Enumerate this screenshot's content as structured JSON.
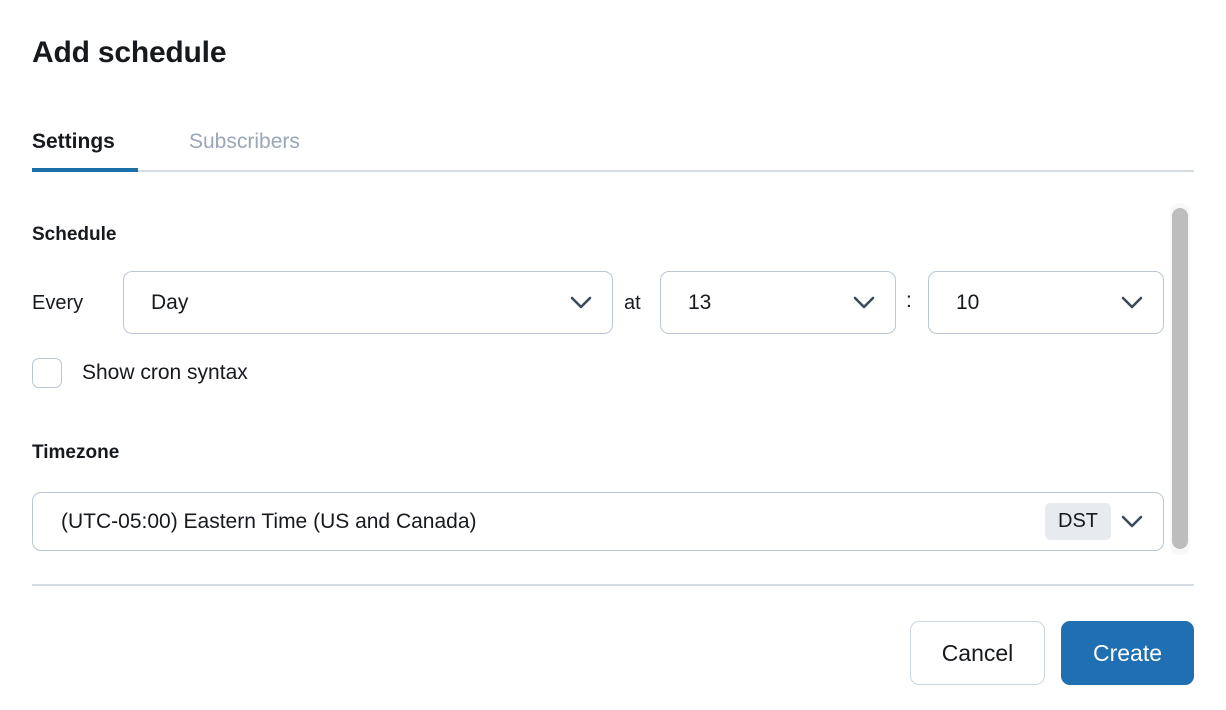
{
  "dialog": {
    "title": "Add schedule"
  },
  "tabs": [
    {
      "label": "Settings",
      "active": true
    },
    {
      "label": "Subscribers",
      "active": false
    }
  ],
  "schedule": {
    "heading": "Schedule",
    "every_label": "Every",
    "frequency_value": "Day",
    "at_label": "at",
    "hour_value": "13",
    "separator": ":",
    "minute_value": "10",
    "cron_checkbox_label": "Show cron syntax",
    "cron_checkbox_checked": false
  },
  "timezone": {
    "heading": "Timezone",
    "value": "(UTC-05:00) Eastern Time (US and Canada)",
    "dst_badge": "DST"
  },
  "footer": {
    "cancel_label": "Cancel",
    "create_label": "Create"
  },
  "icons": {
    "chevron_down": "chevron-down-icon"
  },
  "colors": {
    "accent": "#1b6ea8",
    "primary_button": "#1f6fb2",
    "border": "#b9c6d4",
    "divider": "#d5dbe3",
    "muted_text": "#9aa7b6",
    "badge_bg": "#e7eaee",
    "scrollbar_thumb": "#bdbdbd"
  }
}
